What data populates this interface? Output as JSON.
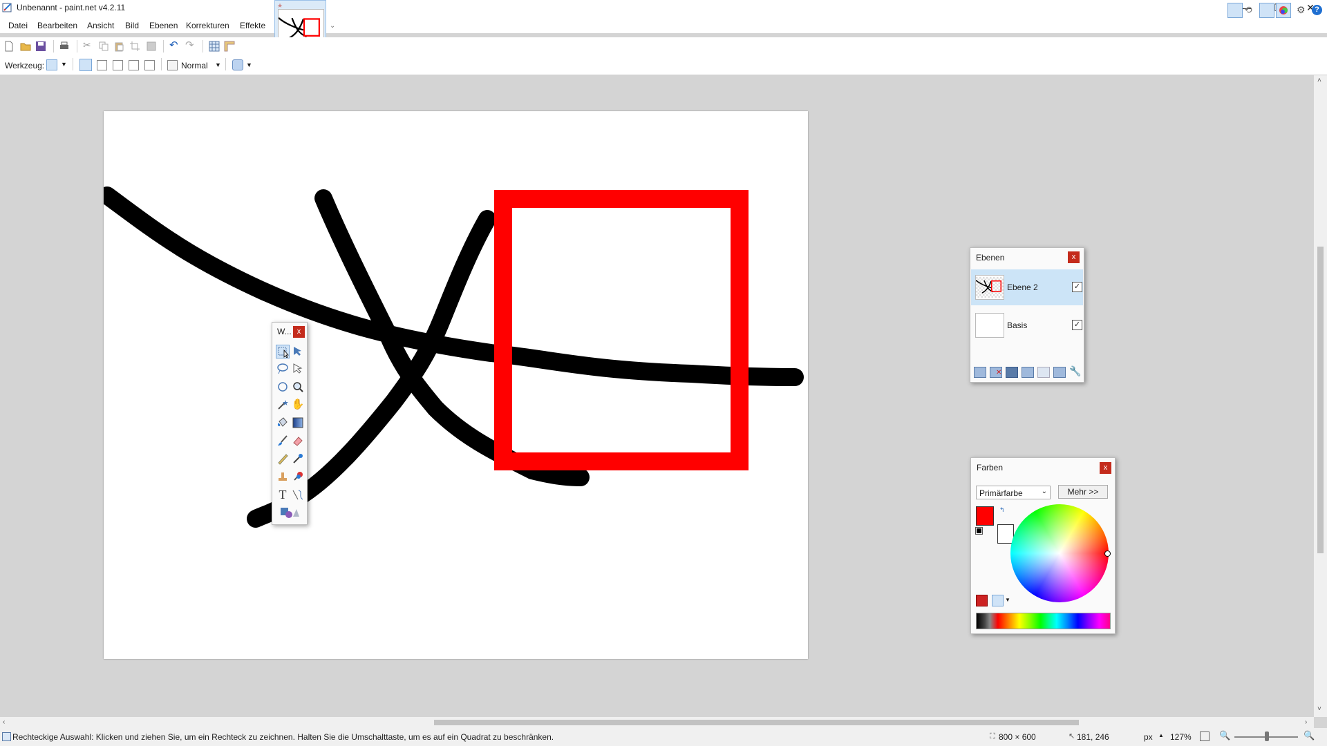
{
  "window": {
    "title": "Unbenannt - paint.net v4.2.11",
    "buttons": {
      "minimize": "—",
      "maximize": "❐",
      "close": "✕"
    }
  },
  "menu": {
    "items": [
      "Datei",
      "Bearbeiten",
      "Ansicht",
      "Bild",
      "Ebenen",
      "Korrekturen",
      "Effekte"
    ]
  },
  "toolbar": {
    "tool_label": "Werkzeug:",
    "blend_mode": "Normal"
  },
  "tools_window": {
    "title": "W...",
    "close": "x",
    "icons": [
      "rectangle-select-icon",
      "move-selection-icon",
      "lasso-select-icon",
      "move-selected-icon",
      "ellipse-select-icon",
      "zoom-icon",
      "magic-wand-icon",
      "pan-icon",
      "paint-bucket-icon",
      "gradient-icon",
      "paintbrush-icon",
      "eraser-icon",
      "pencil-icon",
      "color-picker-icon",
      "clone-stamp-icon",
      "recolor-icon",
      "text-icon",
      "line-curve-icon",
      "shapes-icon"
    ]
  },
  "layers_panel": {
    "title": "Ebenen",
    "close": "x",
    "layers": [
      {
        "name": "Ebene 2",
        "visible": true,
        "selected": true
      },
      {
        "name": "Basis",
        "visible": true,
        "selected": false
      }
    ]
  },
  "colors_panel": {
    "title": "Farben",
    "close": "x",
    "selector": "Primärfarbe",
    "more_button": "Mehr >>",
    "primary_color": "#ff0000",
    "secondary_color": "#ffffff"
  },
  "status": {
    "hint": "Rechteckige Auswahl: Klicken und ziehen Sie, um ein Rechteck zu zeichnen. Halten Sie die Umschalttaste, um es auf ein Quadrat zu beschränken.",
    "image_size": "800 × 600",
    "cursor_pos": "181, 246",
    "units": "px",
    "zoom": "127%"
  },
  "colors": {
    "accent": "#0078d7",
    "close_red": "#c42b1c",
    "drawing_red": "#ff0000",
    "drawing_black": "#000000"
  }
}
